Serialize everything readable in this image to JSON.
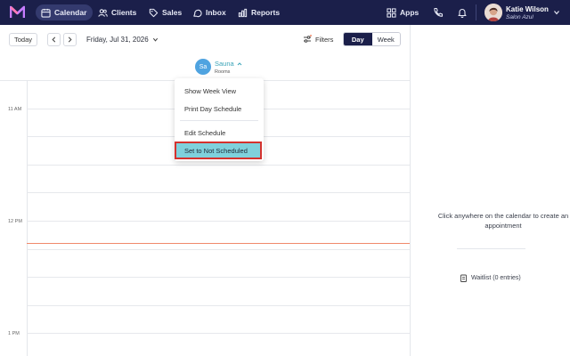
{
  "nav": {
    "items": [
      {
        "label": "Calendar",
        "icon": "calendar-icon",
        "active": true
      },
      {
        "label": "Clients",
        "icon": "clients-icon",
        "active": false
      },
      {
        "label": "Sales",
        "icon": "tag-icon",
        "active": false
      },
      {
        "label": "Inbox",
        "icon": "inbox-icon",
        "active": false
      },
      {
        "label": "Reports",
        "icon": "bar-chart-icon",
        "active": false
      }
    ],
    "apps_label": "Apps",
    "user": {
      "name": "Katie Wilson",
      "salon": "Salon Azul"
    }
  },
  "toolbar": {
    "today_label": "Today",
    "date_label": "Friday, Jul 31, 2026",
    "filters_label": "Filters",
    "view_day": "Day",
    "view_week": "Week"
  },
  "resource": {
    "initials": "Sa",
    "name": "Sauna",
    "subtitle": "Rooms"
  },
  "times": [
    "11 AM",
    "12 PM",
    "1 PM"
  ],
  "menu": {
    "items": [
      "Show Week View",
      "Print Day Schedule",
      "Edit Schedule",
      "Set to Not Scheduled"
    ],
    "highlighted": "Set to Not Scheduled"
  },
  "side_panel": {
    "message": "Click anywhere on the calendar to create an appointment",
    "waitlist_label": "Waitlist (0 entries)"
  },
  "colors": {
    "nav_bg": "#1b1f4a",
    "accent_teal": "#3ba4b8",
    "highlight": "#7fd1dc",
    "highlight_border": "#d4322e",
    "now_line": "#f08a6b",
    "avatar_badge": "#4fa3e0"
  }
}
